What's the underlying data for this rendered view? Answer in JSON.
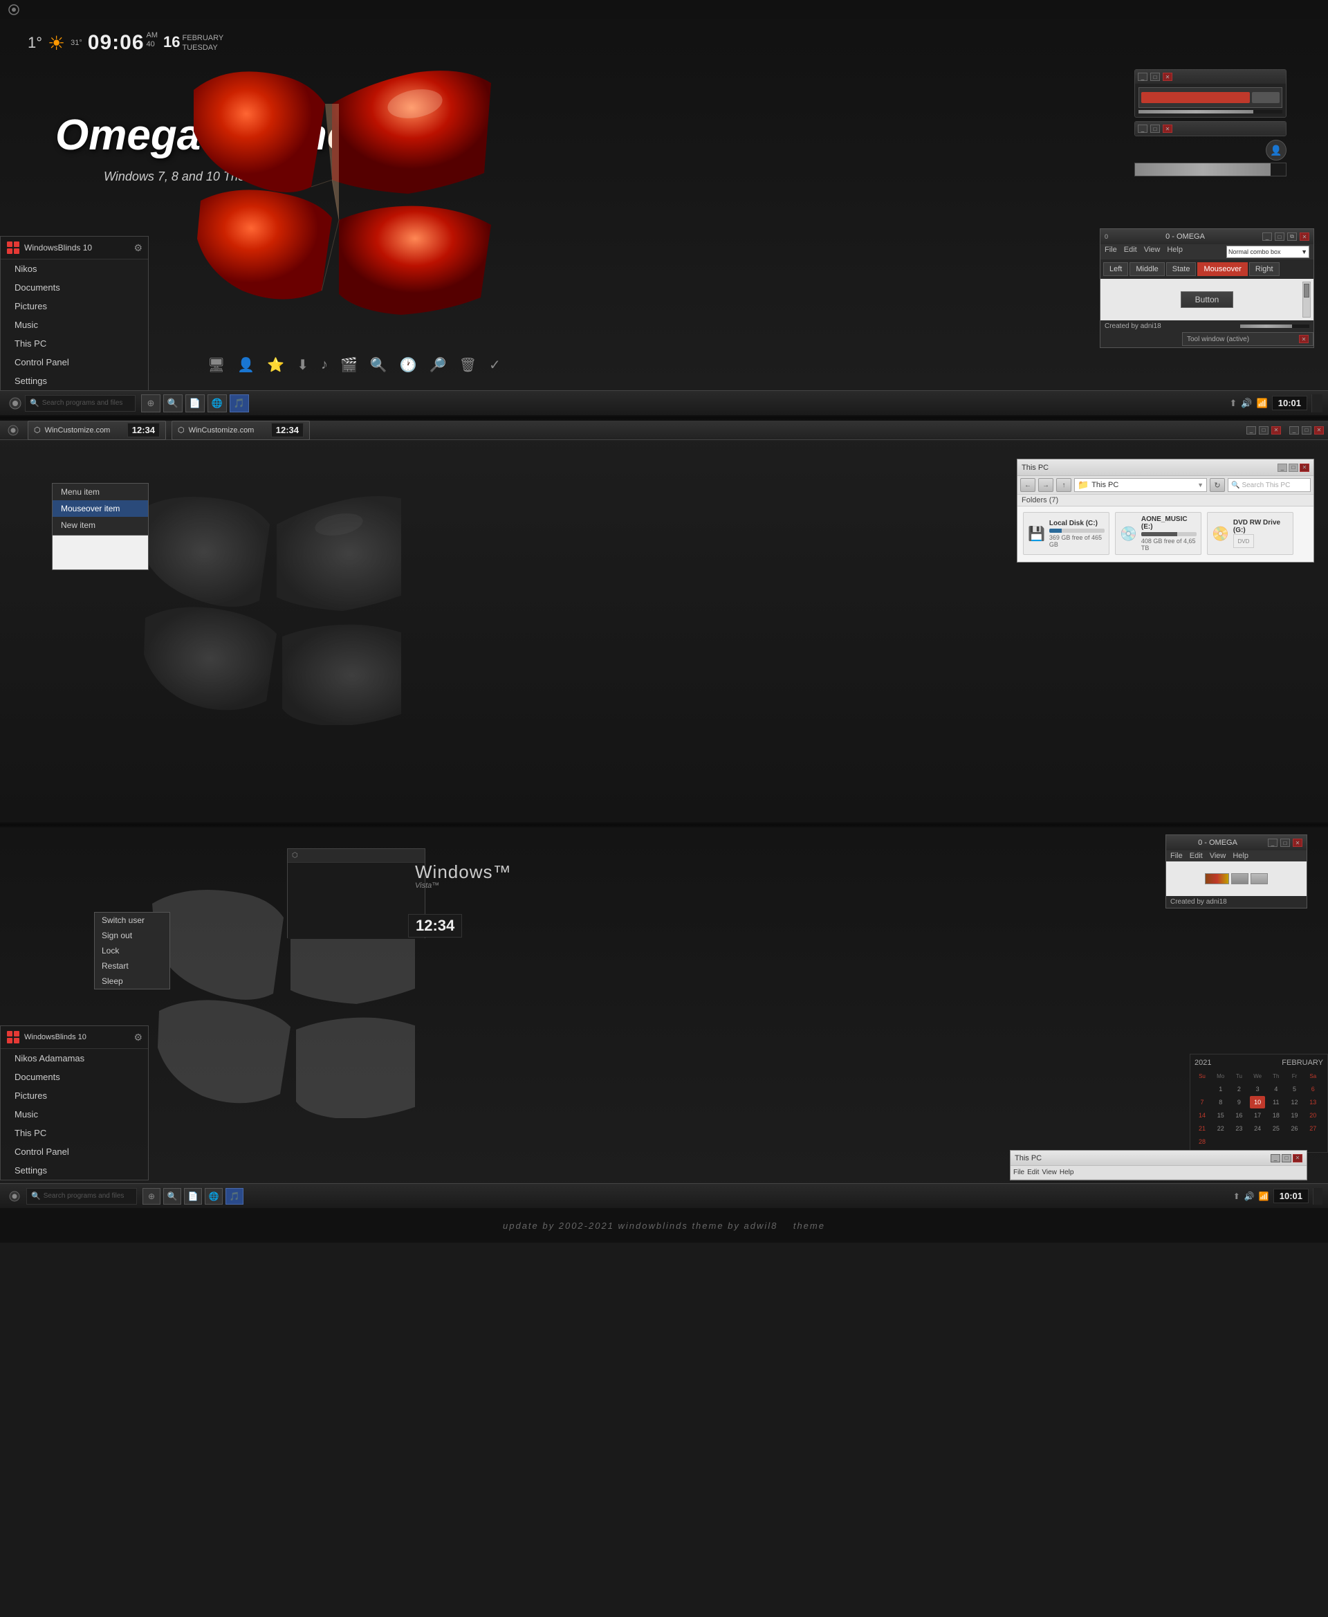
{
  "app": {
    "title": "Omega Theme - Windows 7, 8 and 10 Theme"
  },
  "top_bar": {
    "icon": "⬡"
  },
  "weather": {
    "temp": "1°",
    "sun_icon": "☀",
    "time": "09:06",
    "am": "AM",
    "mo": "40",
    "day_num": "16",
    "month": "FEBRUARY",
    "day_name": "TUESDAY"
  },
  "omega_theme": {
    "title": "Omega Theme",
    "subtitle": "Windows 7, 8 and 10 Theme"
  },
  "omega_window": {
    "title": "0 - OMEGA",
    "menu": [
      "File",
      "Edit",
      "View",
      "Help"
    ],
    "combo_label": "Normal combo box",
    "tabs": [
      "Left",
      "Middle",
      "State",
      "Mouseover",
      "Right"
    ],
    "active_tab": "Mouseover",
    "button_label": "Button",
    "status_left": "Created by adni18",
    "progress_val": 75,
    "tool_window_label": "Tool window (active)"
  },
  "start_menu": {
    "app_name": "WindowsBlinds 10",
    "user_name": "Nikos",
    "items": [
      "Nikos",
      "Documents",
      "Pictures",
      "Music",
      "This PC",
      "Control Panel",
      "Settings"
    ]
  },
  "taskbar_icons": {
    "icons": [
      "🖥",
      "👤",
      "⭐",
      "⬇",
      "🎵",
      "🎬",
      "🔍",
      "🕐",
      "🔎",
      "🗑",
      "✓"
    ]
  },
  "taskbar": {
    "search_placeholder": "Search programs and files",
    "time": "10:01",
    "icons": [
      "⊕",
      "🔊",
      "🌐"
    ]
  },
  "mid_section": {
    "taskbar_items": [
      {
        "label": "WinCustomize.com",
        "time": "12:34"
      },
      {
        "label": "WinCustomize.com",
        "time": "12:34"
      }
    ],
    "context_menu": {
      "items": [
        "Menu item",
        "Mouseover item",
        "New item"
      ]
    }
  },
  "file_explorer": {
    "title": "This PC",
    "address": "This PC",
    "search_placeholder": "Search This PC",
    "folders_label": "Folders (7)",
    "disks": [
      {
        "name": "Local Disk (C:)",
        "fill": 22,
        "space": "369 GB free of 465 GB"
      },
      {
        "name": "AONE_MUSIC (E:)",
        "fill": 65,
        "space": "408 GB free of 4,65 TB"
      },
      {
        "name": "DVD RW Drive (G:)",
        "fill": 0,
        "space": ""
      }
    ]
  },
  "bot_section": {
    "start_menu_user": "Nikos Adamamas",
    "start_menu_items": [
      "Nikos Adamamas",
      "Documents",
      "Pictures",
      "Music",
      "This PC",
      "Control Panel",
      "Settings"
    ],
    "user_popup": [
      "Switch user",
      "Sign out",
      "Lock",
      "Restart",
      "Sleep"
    ],
    "time_display": "12:34"
  },
  "calendar": {
    "year": "2021",
    "month": "FEBRUARY",
    "days_header": [
      "Su",
      "Mo",
      "Tu",
      "We",
      "Th",
      "Fr",
      "Sa"
    ],
    "weeks": [
      [
        "",
        "",
        "2",
        "3",
        "4",
        "5",
        "6"
      ],
      [
        "7",
        "8",
        "9",
        "10",
        "11",
        "12",
        "13"
      ],
      [
        "14",
        "15",
        "16",
        "17",
        "18",
        "19",
        "20"
      ],
      [
        "21",
        "22",
        "23",
        "24",
        "25",
        "26",
        "27"
      ],
      [
        "28",
        "",
        "",
        "",
        "",
        "",
        ""
      ]
    ],
    "today": "10"
  },
  "footer": {
    "text": "update by 2002-2021     windowblinds theme by adwil8",
    "theme_text": "theme"
  },
  "omega_window_bot": {
    "title": "0 - OMEGA",
    "menu": [
      "File",
      "Edit",
      "View",
      "Help"
    ],
    "status_left": "Created by adni18"
  },
  "windows_text": {
    "title": "Windows™",
    "edition": "Vista™"
  }
}
